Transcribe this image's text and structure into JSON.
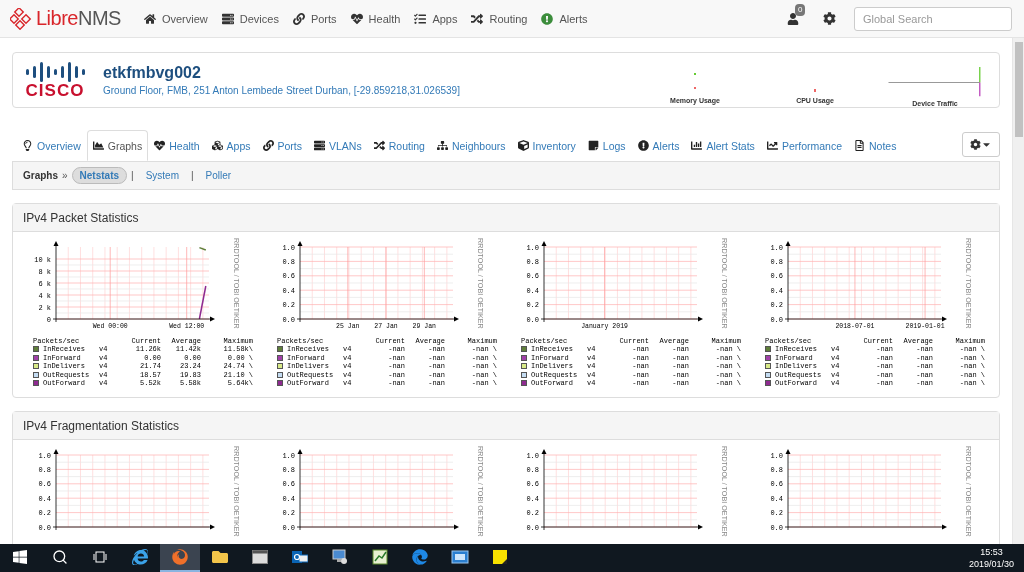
{
  "nav": {
    "logo": [
      {
        "text": "Libre",
        "kind": "accent"
      },
      {
        "text": "NMS",
        "kind": "plain"
      }
    ],
    "items": [
      {
        "label": "Overview"
      },
      {
        "label": "Devices"
      },
      {
        "label": "Ports"
      },
      {
        "label": "Health"
      },
      {
        "label": "Apps"
      },
      {
        "label": "Routing"
      },
      {
        "label": "Alerts"
      }
    ],
    "notifications": {
      "count": "0"
    },
    "search": {
      "placeholder": "Global Search"
    }
  },
  "device": {
    "vendor": "CISCO",
    "name": "etkfmbvg002",
    "location": "Ground Floor, FMB, 251 Anton Lembede Street Durban, [-29.859218,31.026539]",
    "graphs": [
      {
        "label": "Memory Usage"
      },
      {
        "label": "CPU Usage"
      },
      {
        "label": "Device Traffic"
      }
    ]
  },
  "tabs": [
    {
      "label": "Overview",
      "selected": false
    },
    {
      "label": "Graphs",
      "selected": true
    },
    {
      "label": "Health",
      "selected": false
    },
    {
      "label": "Apps",
      "selected": false
    },
    {
      "label": "Ports",
      "selected": false
    },
    {
      "label": "VLANs",
      "selected": false
    },
    {
      "label": "Routing",
      "selected": false
    },
    {
      "label": "Neighbours",
      "selected": false
    },
    {
      "label": "Inventory",
      "selected": false
    },
    {
      "label": "Logs",
      "selected": false
    },
    {
      "label": "Alerts",
      "selected": false
    },
    {
      "label": "Alert Stats",
      "selected": false
    },
    {
      "label": "Performance",
      "selected": false
    },
    {
      "label": "Notes",
      "selected": false
    }
  ],
  "subnav": {
    "title": "Graphs",
    "separator": "»",
    "links": [
      {
        "label": "Netstats",
        "selected": true
      },
      {
        "label": "System",
        "selected": false,
        "divider": "|"
      },
      {
        "label": "Poller",
        "selected": false,
        "divider": "|"
      }
    ]
  },
  "panels": [
    {
      "title": "IPv4 Packet Statistics",
      "graphs": [
        {
          "side_label": "RRDTOOL / TOBI OETIKER",
          "chart_data": {
            "type": "line",
            "grid": true,
            "ylim": [
              0,
              12000
            ],
            "categories": [
              null,
              null,
              null,
              null,
              null,
              null,
              null,
              null,
              "Wed 00:00",
              null,
              null,
              null,
              null,
              null,
              null,
              null,
              null,
              null,
              null,
              null,
              "Wed 12:00",
              null,
              null,
              null
            ],
            "yticks": [
              {
                "value": 0,
                "label": "0"
              },
              {
                "value": 2000,
                "label": "2 k"
              },
              {
                "value": 4000,
                "label": "4 k"
              },
              {
                "value": 6000,
                "label": "6 k"
              },
              {
                "value": 8000,
                "label": "8 k"
              },
              {
                "value": 10000,
                "label": "10 k"
              }
            ],
            "series": [
              {
                "name": "InReceives",
                "color": "#5f7f3a",
                "values": [
                  null,
                  null,
                  null,
                  null,
                  null,
                  null,
                  null,
                  null,
                  null,
                  null,
                  null,
                  null,
                  null,
                  null,
                  null,
                  null,
                  null,
                  null,
                  null,
                  null,
                  null,
                  null,
                  11900,
                  11500
                ]
              },
              {
                "name": "InForward",
                "color": "#a040a8",
                "values": [
                  null,
                  null,
                  null,
                  null,
                  null,
                  null,
                  null,
                  null,
                  null,
                  null,
                  null,
                  null,
                  null,
                  null,
                  null,
                  null,
                  null,
                  null,
                  null,
                  null,
                  null,
                  null,
                  null,
                  null
                ]
              },
              {
                "name": "InDelivers",
                "color": "#d8ea88",
                "values": [
                  null,
                  null,
                  null,
                  null,
                  null,
                  null,
                  null,
                  null,
                  null,
                  null,
                  null,
                  null,
                  null,
                  null,
                  null,
                  null,
                  null,
                  null,
                  null,
                  null,
                  null,
                  null,
                  null,
                  null
                ]
              },
              {
                "name": "OutRequests",
                "color": "#c4dcf2",
                "values": [
                  null,
                  null,
                  null,
                  null,
                  null,
                  null,
                  null,
                  null,
                  null,
                  null,
                  null,
                  null,
                  null,
                  null,
                  null,
                  null,
                  null,
                  null,
                  null,
                  null,
                  null,
                  null,
                  null,
                  null
                ]
              },
              {
                "name": "OutForward",
                "color": "#8e2a90",
                "values": [
                  null,
                  null,
                  null,
                  null,
                  null,
                  null,
                  null,
                  null,
                  null,
                  null,
                  null,
                  null,
                  null,
                  null,
                  null,
                  null,
                  null,
                  null,
                  null,
                  null,
                  null,
                  null,
                  0,
                  5500
                ]
              }
            ]
          },
          "legend": {
            "columns": [
              "Packets/sec",
              "Current",
              "Average",
              "Maximum"
            ],
            "rows": [
              {
                "version": "v4",
                "current": "11.26k",
                "average": "11.42k",
                "maximum": "11.58k\\"
              },
              {
                "version": "v4",
                "current": "0.00",
                "average": "0.00",
                "maximum": "0.00 \\"
              },
              {
                "version": "v4",
                "current": "21.74",
                "average": "23.24",
                "maximum": "24.74 \\"
              },
              {
                "version": "v4",
                "current": "18.57",
                "average": "19.83",
                "maximum": "21.10 \\"
              },
              {
                "version": "v4",
                "current": "5.52k",
                "average": "5.58k",
                "maximum": "5.64k\\"
              }
            ]
          }
        },
        {
          "side_label": "RRDTOOL / TOBI OETIKER",
          "chart_data": {
            "type": "line",
            "grid": true,
            "ylim": [
              0,
              1
            ],
            "categories": [
              null,
              null,
              null,
              null,
              null,
              null,
              null,
              "25 Jan",
              null,
              null,
              null,
              null,
              null,
              "27 Jan",
              null,
              null,
              null,
              null,
              null,
              "29 Jan",
              null,
              null,
              null,
              null
            ],
            "yticks": [
              {
                "value": 0,
                "label": "0.0"
              },
              {
                "value": 0.2,
                "label": "0.2"
              },
              {
                "value": 0.4,
                "label": "0.4"
              },
              {
                "value": 0.6,
                "label": "0.6"
              },
              {
                "value": 0.8,
                "label": "0.8"
              },
              {
                "value": 1,
                "label": "1.0"
              }
            ],
            "series": [
              {
                "name": "InReceives",
                "color": "#5f7f3a",
                "values": [
                  null,
                  null,
                  null,
                  null,
                  null,
                  null,
                  null,
                  null,
                  null,
                  null,
                  null,
                  null,
                  null,
                  null,
                  null,
                  null,
                  null,
                  null,
                  null,
                  null,
                  null,
                  null,
                  null,
                  null
                ]
              },
              {
                "name": "InForward",
                "color": "#a040a8",
                "values": [
                  null,
                  null,
                  null,
                  null,
                  null,
                  null,
                  null,
                  null,
                  null,
                  null,
                  null,
                  null,
                  null,
                  null,
                  null,
                  null,
                  null,
                  null,
                  null,
                  null,
                  null,
                  null,
                  null,
                  null
                ]
              },
              {
                "name": "InDelivers",
                "color": "#d8ea88",
                "values": [
                  null,
                  null,
                  null,
                  null,
                  null,
                  null,
                  null,
                  null,
                  null,
                  null,
                  null,
                  null,
                  null,
                  null,
                  null,
                  null,
                  null,
                  null,
                  null,
                  null,
                  null,
                  null,
                  null,
                  null
                ]
              },
              {
                "name": "OutRequests",
                "color": "#c4dcf2",
                "values": [
                  null,
                  null,
                  null,
                  null,
                  null,
                  null,
                  null,
                  null,
                  null,
                  null,
                  null,
                  null,
                  null,
                  null,
                  null,
                  null,
                  null,
                  null,
                  null,
                  null,
                  null,
                  null,
                  null,
                  null
                ]
              },
              {
                "name": "OutForward",
                "color": "#8e2a90",
                "values": [
                  null,
                  null,
                  null,
                  null,
                  null,
                  null,
                  null,
                  null,
                  null,
                  null,
                  null,
                  null,
                  null,
                  null,
                  null,
                  null,
                  null,
                  null,
                  null,
                  null,
                  null,
                  null,
                  null,
                  null
                ]
              }
            ]
          },
          "legend": {
            "columns": [
              "Packets/sec",
              "Current",
              "Average",
              "Maximum"
            ],
            "rows": [
              {
                "version": "v4",
                "current": "-nan",
                "average": "-nan",
                "maximum": "-nan \\"
              },
              {
                "version": "v4",
                "current": "-nan",
                "average": "-nan",
                "maximum": "-nan \\"
              },
              {
                "version": "v4",
                "current": "-nan",
                "average": "-nan",
                "maximum": "-nan \\"
              },
              {
                "version": "v4",
                "current": "-nan",
                "average": "-nan",
                "maximum": "-nan \\"
              },
              {
                "version": "v4",
                "current": "-nan",
                "average": "-nan",
                "maximum": "-nan \\"
              }
            ]
          }
        },
        {
          "side_label": "RRDTOOL / TOBI OETIKER",
          "chart_data": {
            "type": "line",
            "grid": true,
            "ylim": [
              0,
              1
            ],
            "categories": [
              null,
              null,
              null,
              null,
              null,
              null,
              null,
              null,
              null,
              "January 2019",
              null,
              null,
              null,
              null,
              null,
              null,
              null,
              null,
              null,
              null,
              null,
              null,
              null,
              null
            ],
            "yticks": [
              {
                "value": 0,
                "label": "0.0"
              },
              {
                "value": 0.2,
                "label": "0.2"
              },
              {
                "value": 0.4,
                "label": "0.4"
              },
              {
                "value": 0.6,
                "label": "0.6"
              },
              {
                "value": 0.8,
                "label": "0.8"
              },
              {
                "value": 1,
                "label": "1.0"
              }
            ],
            "series": [
              {
                "name": "InReceives",
                "color": "#5f7f3a",
                "values": [
                  null,
                  null,
                  null,
                  null,
                  null,
                  null,
                  null,
                  null,
                  null,
                  null,
                  null,
                  null,
                  null,
                  null,
                  null,
                  null,
                  null,
                  null,
                  null,
                  null,
                  null,
                  null,
                  null,
                  null
                ]
              },
              {
                "name": "InForward",
                "color": "#a040a8",
                "values": [
                  null,
                  null,
                  null,
                  null,
                  null,
                  null,
                  null,
                  null,
                  null,
                  null,
                  null,
                  null,
                  null,
                  null,
                  null,
                  null,
                  null,
                  null,
                  null,
                  null,
                  null,
                  null,
                  null,
                  null
                ]
              },
              {
                "name": "InDelivers",
                "color": "#d8ea88",
                "values": [
                  null,
                  null,
                  null,
                  null,
                  null,
                  null,
                  null,
                  null,
                  null,
                  null,
                  null,
                  null,
                  null,
                  null,
                  null,
                  null,
                  null,
                  null,
                  null,
                  null,
                  null,
                  null,
                  null,
                  null
                ]
              },
              {
                "name": "OutRequests",
                "color": "#c4dcf2",
                "values": [
                  null,
                  null,
                  null,
                  null,
                  null,
                  null,
                  null,
                  null,
                  null,
                  null,
                  null,
                  null,
                  null,
                  null,
                  null,
                  null,
                  null,
                  null,
                  null,
                  null,
                  null,
                  null,
                  null,
                  null
                ]
              },
              {
                "name": "OutForward",
                "color": "#8e2a90",
                "values": [
                  null,
                  null,
                  null,
                  null,
                  null,
                  null,
                  null,
                  null,
                  null,
                  null,
                  null,
                  null,
                  null,
                  null,
                  null,
                  null,
                  null,
                  null,
                  null,
                  null,
                  null,
                  null,
                  null,
                  null
                ]
              }
            ]
          },
          "legend": {
            "columns": [
              "Packets/sec",
              "Current",
              "Average",
              "Maximum"
            ],
            "rows": [
              {
                "version": "v4",
                "current": "-nan",
                "average": "-nan",
                "maximum": "-nan \\"
              },
              {
                "version": "v4",
                "current": "-nan",
                "average": "-nan",
                "maximum": "-nan \\"
              },
              {
                "version": "v4",
                "current": "-nan",
                "average": "-nan",
                "maximum": "-nan \\"
              },
              {
                "version": "v4",
                "current": "-nan",
                "average": "-nan",
                "maximum": "-nan \\"
              },
              {
                "version": "v4",
                "current": "-nan",
                "average": "-nan",
                "maximum": "-nan \\"
              }
            ]
          }
        },
        {
          "side_label": "RRDTOOL / TOBI OETIKER",
          "chart_data": {
            "type": "line",
            "grid": true,
            "ylim": [
              0,
              1
            ],
            "categories": [
              null,
              null,
              null,
              null,
              null,
              null,
              null,
              null,
              null,
              null,
              "2018-07-01",
              null,
              null,
              null,
              null,
              null,
              null,
              null,
              null,
              null,
              null,
              "2019-01-01",
              null,
              null
            ],
            "yticks": [
              {
                "value": 0,
                "label": "0.0"
              },
              {
                "value": 0.2,
                "label": "0.2"
              },
              {
                "value": 0.4,
                "label": "0.4"
              },
              {
                "value": 0.6,
                "label": "0.6"
              },
              {
                "value": 0.8,
                "label": "0.8"
              },
              {
                "value": 1,
                "label": "1.0"
              }
            ],
            "series": [
              {
                "name": "InReceives",
                "color": "#5f7f3a",
                "values": [
                  null,
                  null,
                  null,
                  null,
                  null,
                  null,
                  null,
                  null,
                  null,
                  null,
                  null,
                  null,
                  null,
                  null,
                  null,
                  null,
                  null,
                  null,
                  null,
                  null,
                  null,
                  null,
                  null,
                  null
                ]
              },
              {
                "name": "InForward",
                "color": "#a040a8",
                "values": [
                  null,
                  null,
                  null,
                  null,
                  null,
                  null,
                  null,
                  null,
                  null,
                  null,
                  null,
                  null,
                  null,
                  null,
                  null,
                  null,
                  null,
                  null,
                  null,
                  null,
                  null,
                  null,
                  null,
                  null
                ]
              },
              {
                "name": "InDelivers",
                "color": "#d8ea88",
                "values": [
                  null,
                  null,
                  null,
                  null,
                  null,
                  null,
                  null,
                  null,
                  null,
                  null,
                  null,
                  null,
                  null,
                  null,
                  null,
                  null,
                  null,
                  null,
                  null,
                  null,
                  null,
                  null,
                  null,
                  null
                ]
              },
              {
                "name": "OutRequests",
                "color": "#c4dcf2",
                "values": [
                  null,
                  null,
                  null,
                  null,
                  null,
                  null,
                  null,
                  null,
                  null,
                  null,
                  null,
                  null,
                  null,
                  null,
                  null,
                  null,
                  null,
                  null,
                  null,
                  null,
                  null,
                  null,
                  null,
                  null
                ]
              },
              {
                "name": "OutForward",
                "color": "#8e2a90",
                "values": [
                  null,
                  null,
                  null,
                  null,
                  null,
                  null,
                  null,
                  null,
                  null,
                  null,
                  null,
                  null,
                  null,
                  null,
                  null,
                  null,
                  null,
                  null,
                  null,
                  null,
                  null,
                  null,
                  null,
                  null
                ]
              }
            ]
          },
          "legend": {
            "columns": [
              "Packets/sec",
              "Current",
              "Average",
              "Maximum"
            ],
            "rows": [
              {
                "version": "v4",
                "current": "-nan",
                "average": "-nan",
                "maximum": "-nan \\"
              },
              {
                "version": "v4",
                "current": "-nan",
                "average": "-nan",
                "maximum": "-nan \\"
              },
              {
                "version": "v4",
                "current": "-nan",
                "average": "-nan",
                "maximum": "-nan \\"
              },
              {
                "version": "v4",
                "current": "-nan",
                "average": "-nan",
                "maximum": "-nan \\"
              },
              {
                "version": "v4",
                "current": "-nan",
                "average": "-nan",
                "maximum": "-nan \\"
              }
            ]
          }
        }
      ]
    },
    {
      "title": "IPv4 Fragmentation Statistics",
      "graphs": [
        {
          "side_label": "RRDTOOL / TOBI OETIKER",
          "chart_data": {
            "type": "line",
            "grid": true,
            "ylim": [
              0,
              1
            ],
            "categories": [
              null,
              null,
              null,
              null,
              null,
              null,
              null,
              null,
              null,
              null,
              null,
              null,
              null,
              null,
              null,
              null,
              null,
              null,
              null,
              null,
              null,
              null,
              null,
              null
            ],
            "yticks": [
              {
                "value": 0,
                "label": "0.0"
              },
              {
                "value": 0.2,
                "label": "0.2"
              },
              {
                "value": 0.4,
                "label": "0.4"
              },
              {
                "value": 0.6,
                "label": "0.6"
              },
              {
                "value": 0.8,
                "label": "0.8"
              },
              {
                "value": 1,
                "label": "1.0"
              }
            ]
          }
        },
        {
          "side_label": "RRDTOOL / TOBI OETIKER",
          "chart_data": {
            "type": "line",
            "grid": true,
            "ylim": [
              0,
              1
            ],
            "categories": [
              null,
              null,
              null,
              null,
              null,
              null,
              null,
              null,
              null,
              null,
              null,
              null,
              null,
              null,
              null,
              null,
              null,
              null,
              null,
              null,
              null,
              null,
              null,
              null
            ],
            "yticks": [
              {
                "value": 0,
                "label": "0.0"
              },
              {
                "value": 0.2,
                "label": "0.2"
              },
              {
                "value": 0.4,
                "label": "0.4"
              },
              {
                "value": 0.6,
                "label": "0.6"
              },
              {
                "value": 0.8,
                "label": "0.8"
              },
              {
                "value": 1,
                "label": "1.0"
              }
            ]
          }
        },
        {
          "side_label": "RRDTOOL / TOBI OETIKER",
          "chart_data": {
            "type": "line",
            "grid": true,
            "ylim": [
              0,
              1
            ],
            "categories": [
              null,
              null,
              null,
              null,
              null,
              null,
              null,
              null,
              null,
              null,
              null,
              null,
              null,
              null,
              null,
              null,
              null,
              null,
              null,
              null,
              null,
              null,
              null,
              null
            ],
            "yticks": [
              {
                "value": 0,
                "label": "0.0"
              },
              {
                "value": 0.2,
                "label": "0.2"
              },
              {
                "value": 0.4,
                "label": "0.4"
              },
              {
                "value": 0.6,
                "label": "0.6"
              },
              {
                "value": 0.8,
                "label": "0.8"
              },
              {
                "value": 1,
                "label": "1.0"
              }
            ]
          }
        },
        {
          "side_label": "RRDTOOL / TOBI OETIKER",
          "chart_data": {
            "type": "line",
            "grid": true,
            "ylim": [
              0,
              1
            ],
            "categories": [
              null,
              null,
              null,
              null,
              null,
              null,
              null,
              null,
              null,
              null,
              null,
              null,
              null,
              null,
              null,
              null,
              null,
              null,
              null,
              null,
              null,
              null,
              null,
              null
            ],
            "yticks": [
              {
                "value": 0,
                "label": "0.0"
              },
              {
                "value": 0.2,
                "label": "0.2"
              },
              {
                "value": 0.4,
                "label": "0.4"
              },
              {
                "value": 0.6,
                "label": "0.6"
              },
              {
                "value": 0.8,
                "label": "0.8"
              },
              {
                "value": 1,
                "label": "1.0"
              }
            ]
          }
        }
      ]
    }
  ],
  "taskbar": {
    "apps": [
      {
        "selected": false
      },
      {
        "selected": true
      },
      {
        "selected": false
      },
      {
        "selected": false
      },
      {
        "selected": false
      },
      {
        "selected": false
      },
      {
        "selected": false
      },
      {
        "selected": false
      },
      {
        "selected": false
      },
      {
        "selected": false
      }
    ],
    "time": "15:53",
    "date": "2019/01/30"
  }
}
